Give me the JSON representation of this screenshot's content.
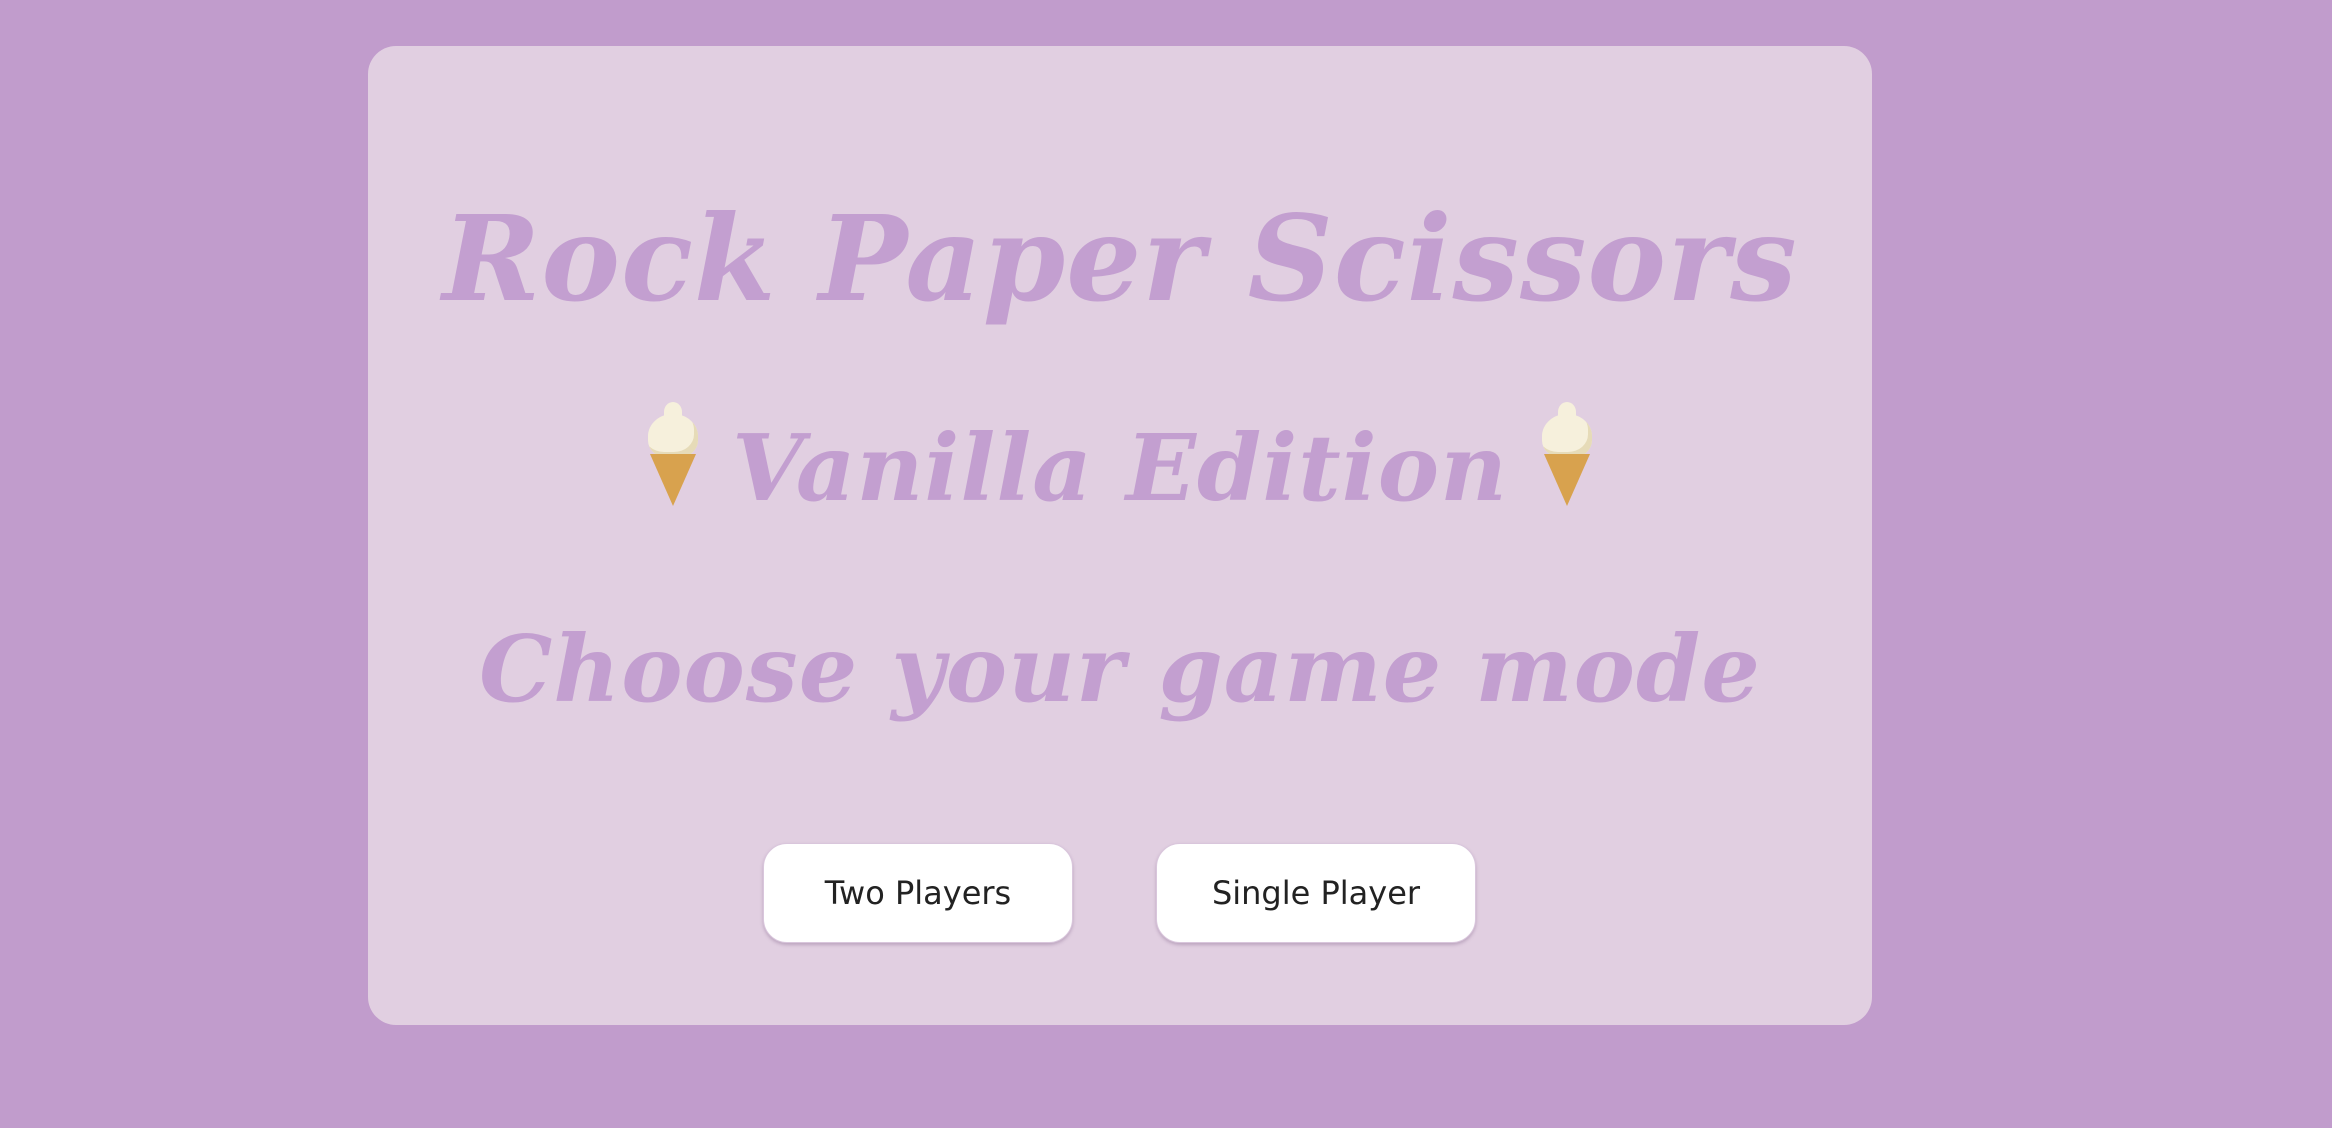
{
  "header": {
    "title": "Rock Paper Scissors",
    "edition": "Vanilla Edition",
    "prompt": "Choose your game mode"
  },
  "icons": {
    "edition_left": "soft-ice-cream-icon",
    "edition_right": "soft-ice-cream-icon"
  },
  "modes": {
    "two_players_label": "Two Players",
    "single_player_label": "Single Player"
  },
  "colors": {
    "background": "#c19ccc",
    "card": "#e1cfe1",
    "heading": "#c39fd0",
    "button": "#ffffff"
  }
}
